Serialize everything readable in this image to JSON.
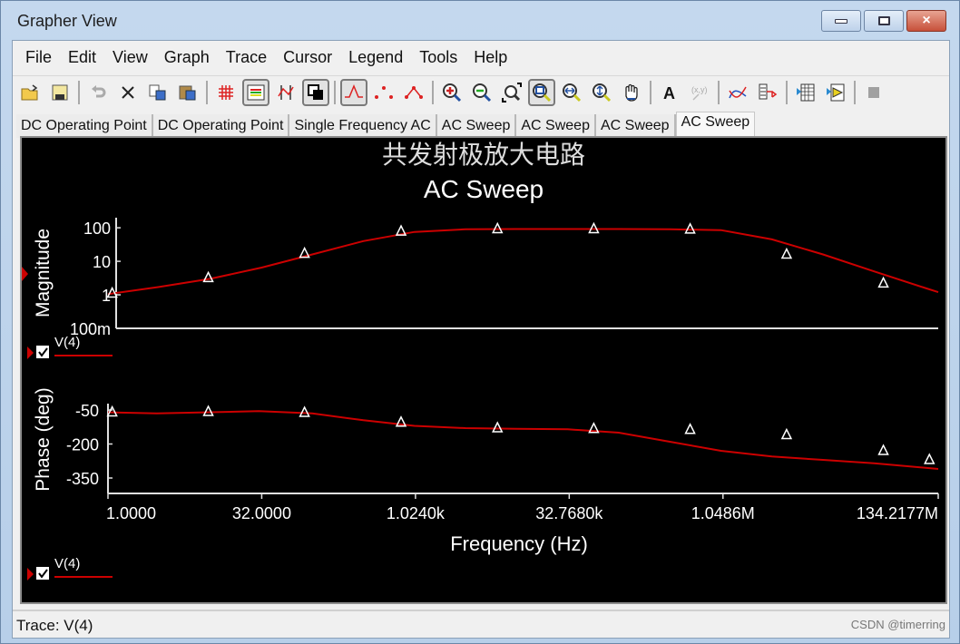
{
  "window": {
    "title": "Grapher View",
    "buttons": {
      "minimize": "minimize",
      "maximize": "maximize",
      "close": "×"
    }
  },
  "menu": [
    "File",
    "Edit",
    "View",
    "Graph",
    "Trace",
    "Cursor",
    "Legend",
    "Tools",
    "Help"
  ],
  "toolbar": [
    {
      "icon": "open-folder-icon",
      "pressed": false
    },
    {
      "icon": "save-icon",
      "pressed": false
    },
    {
      "sep": true
    },
    {
      "icon": "undo-icon",
      "pressed": false
    },
    {
      "icon": "delete-icon",
      "pressed": false
    },
    {
      "icon": "copy-icon",
      "pressed": false
    },
    {
      "icon": "paste-icon",
      "pressed": false
    },
    {
      "sep": true
    },
    {
      "icon": "grid-icon",
      "pressed": false
    },
    {
      "icon": "legend-icon",
      "pressed": true
    },
    {
      "icon": "cursors-icon",
      "pressed": false
    },
    {
      "icon": "reverse-colors-icon",
      "pressed": true
    },
    {
      "sep": true
    },
    {
      "icon": "show-lines-icon",
      "pressed": true
    },
    {
      "icon": "show-points-icon",
      "pressed": false
    },
    {
      "icon": "show-lines-points-icon",
      "pressed": false
    },
    {
      "sep": true
    },
    {
      "icon": "zoom-in-icon",
      "pressed": false
    },
    {
      "icon": "zoom-out-icon",
      "pressed": false
    },
    {
      "icon": "zoom-full-icon",
      "pressed": false
    },
    {
      "icon": "zoom-area-icon",
      "pressed": true
    },
    {
      "icon": "zoom-x-icon",
      "pressed": false
    },
    {
      "icon": "zoom-y-icon",
      "pressed": false
    },
    {
      "icon": "pan-hand-icon",
      "pressed": false
    },
    {
      "sep": true
    },
    {
      "icon": "text-label-icon",
      "pressed": false
    },
    {
      "icon": "xy-label-icon",
      "pressed": false,
      "disabled": true
    },
    {
      "sep": true
    },
    {
      "icon": "overlay-traces-icon",
      "pressed": false
    },
    {
      "icon": "export-excel-icon",
      "pressed": false
    },
    {
      "sep": true
    },
    {
      "icon": "export-table-icon",
      "pressed": false
    },
    {
      "icon": "export-labview-icon",
      "pressed": false
    },
    {
      "sep": true
    },
    {
      "icon": "stop-icon",
      "pressed": false,
      "disabled": true
    }
  ],
  "tabs": [
    {
      "label": "DC Operating Point",
      "active": false
    },
    {
      "label": "DC Operating Point",
      "active": false
    },
    {
      "label": "Single Frequency AC",
      "active": false
    },
    {
      "label": "AC Sweep",
      "active": false
    },
    {
      "label": "AC Sweep",
      "active": false
    },
    {
      "label": "AC Sweep",
      "active": false
    },
    {
      "label": "AC Sweep",
      "active": true
    }
  ],
  "status": {
    "text": "Trace: V(4)"
  },
  "watermark": "CSDN @timerring",
  "colors": {
    "trace": "#cc0000",
    "background": "#000000",
    "axis": "#e0e0e0",
    "text": "#ffffff"
  },
  "chart_data": [
    {
      "type": "line",
      "title": "共发射极放大电路",
      "subtitle": "AC Sweep",
      "xlabel": "Frequency (Hz)",
      "ylabel": "Magnitude",
      "xscale": "log",
      "yscale": "log",
      "xlim": [
        1,
        134217728
      ],
      "ylim": [
        0.1,
        200
      ],
      "x_ticks": [
        {
          "value": 1,
          "label": "1.0000"
        },
        {
          "value": 32,
          "label": "32.0000"
        },
        {
          "value": 1024,
          "label": "1.0240k"
        },
        {
          "value": 32768,
          "label": "32.7680k"
        },
        {
          "value": 1048576,
          "label": "1.0486M"
        },
        {
          "value": 134217728,
          "label": "134.2177M"
        }
      ],
      "y_ticks": [
        {
          "value": 100,
          "label": "100"
        },
        {
          "value": 10,
          "label": "10"
        },
        {
          "value": 1,
          "label": "1"
        },
        {
          "value": 0.1,
          "label": "100m"
        }
      ],
      "legend": {
        "entries": [
          "V(4)"
        ],
        "placement": "bottom-left",
        "checked": true
      },
      "series": [
        {
          "name": "V(4)",
          "marker": "triangle",
          "x": [
            1,
            3.1,
            10,
            32,
            100,
            316,
            1000,
            3162,
            10000,
            31623,
            100000,
            316228,
            1000000,
            3162278,
            10000000,
            31622777,
            100000000,
            134217728
          ],
          "values": [
            1.05,
            1.7,
            3.0,
            6.5,
            16,
            40,
            75,
            90,
            92,
            92,
            92,
            90,
            85,
            45,
            16,
            5,
            1.6,
            1.2
          ]
        }
      ],
      "markers_x": [
        1.1,
        9.6,
        84,
        740,
        6500,
        57000,
        500000,
        4400000,
        39000000
      ],
      "markers_y": [
        1.1,
        3.2,
        17,
        78,
        92,
        92,
        90,
        16,
        2.2
      ]
    },
    {
      "type": "line",
      "xlabel": "Frequency (Hz)",
      "ylabel": "Phase (deg)",
      "xscale": "log",
      "xlim": [
        1,
        134217728
      ],
      "ylim": [
        -400,
        0
      ],
      "y_ticks": [
        {
          "value": -50,
          "label": "-50"
        },
        {
          "value": -200,
          "label": "-200"
        },
        {
          "value": -350,
          "label": "-350"
        }
      ],
      "legend": {
        "entries": [
          "V(4)"
        ],
        "placement": "bottom-left",
        "checked": true
      },
      "series": [
        {
          "name": "V(4)",
          "marker": "triangle",
          "x": [
            1,
            3,
            10,
            30,
            100,
            316,
            1000,
            3162,
            10000,
            31623,
            100000,
            316228,
            1000000,
            3162278,
            10000000,
            31622777,
            134217728
          ],
          "values": [
            -60,
            -65,
            -60,
            -55,
            -65,
            -95,
            -120,
            -130,
            -133,
            -135,
            -150,
            -190,
            -230,
            -255,
            -270,
            -285,
            -310
          ]
        }
      ],
      "markers_x": [
        1.1,
        9.6,
        84,
        740,
        6500,
        57000,
        500000,
        4400000,
        39000000,
        110000000
      ],
      "markers_y": [
        -60,
        -58,
        -62,
        -105,
        -130,
        -133,
        -137,
        -160,
        -230,
        -270
      ]
    }
  ]
}
